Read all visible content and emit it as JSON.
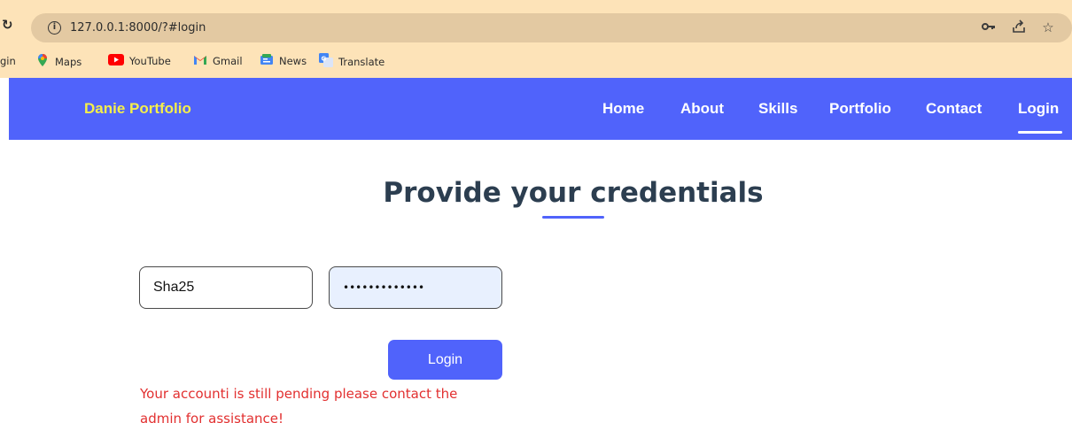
{
  "browser": {
    "url": "127.0.0.1:8000/?#login",
    "bookmarks": [
      {
        "label": "gin",
        "icon": "bookmark-fragment"
      },
      {
        "label": "Maps",
        "icon": "maps-icon"
      },
      {
        "label": "YouTube",
        "icon": "youtube-icon"
      },
      {
        "label": "Gmail",
        "icon": "gmail-icon"
      },
      {
        "label": "News",
        "icon": "news-icon"
      },
      {
        "label": "Translate",
        "icon": "translate-icon"
      }
    ]
  },
  "navbar": {
    "brand": "Danie Portfolio",
    "links": [
      "Home",
      "About",
      "Skills",
      "Portfolio",
      "Contact",
      "Login"
    ],
    "active": "Login"
  },
  "main": {
    "title": "Provide your credentials",
    "username_value": "Sha25",
    "password_value": "•••••••••••••",
    "login_button": "Login",
    "error_message": "Your accounti is still pending please contact the admin for assistance!"
  },
  "colors": {
    "chrome": "#fde3b8",
    "navbar": "#5063fb",
    "brand": "#f5ef4a",
    "error": "#e23030"
  }
}
